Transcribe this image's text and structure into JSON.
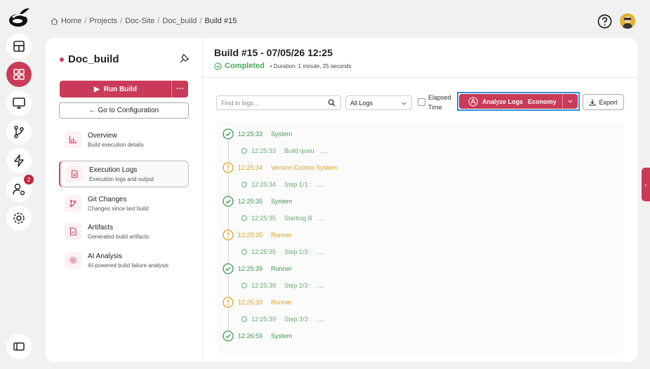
{
  "breadcrumb": [
    "Home",
    "Projects",
    "Doc-Site",
    "Doc_build",
    "Build #15"
  ],
  "colors": {
    "accent": "#c93b58",
    "success": "#4aa85a",
    "warning": "#e0a022",
    "highlight": "#2f8fd8"
  },
  "rail": {
    "icons": [
      "logo-icon",
      "dashboard-icon",
      "apps-grid-icon",
      "monitor-icon",
      "git-branch-icon",
      "lightning-icon",
      "user-settings-icon",
      "settings-gear-icon",
      "sidebar-toggle-icon"
    ],
    "user_badge": "2"
  },
  "sidebar": {
    "project_name": "Doc_build",
    "run_build": "Run Build",
    "run_more": "···",
    "go_config": "← Go to Configuration",
    "items": [
      {
        "label": "Overview",
        "desc": "Build execution details",
        "icon": "chart-icon"
      },
      {
        "label": "Execution Logs",
        "desc": "Execution logs and output",
        "icon": "document-icon"
      },
      {
        "label": "Git Changes",
        "desc": "Changes since last build",
        "icon": "git-branch-icon"
      },
      {
        "label": "Artifacts",
        "desc": "Generated build artifacts",
        "icon": "file-icon"
      },
      {
        "label": "AI Analysis",
        "desc": "AI-powered build failure analysis",
        "icon": "gear-icon"
      }
    ]
  },
  "header": {
    "title": "Build #15 - 07/05/26 12:25",
    "status": "Completed",
    "duration": "• Duration: 1 minute, 25 seconds"
  },
  "toolbar": {
    "search_placeholder": "Find in logs...",
    "filter_selected": "All Logs",
    "elapsed_label": "Elapsed Time",
    "analyze_label": "Analyze Logs",
    "analyze_tier": "Economy",
    "export_label": "Export"
  },
  "logs": [
    {
      "kind": "step",
      "status": "success",
      "time": "12:25:33",
      "msg": "System"
    },
    {
      "kind": "sub",
      "time": "12:25:33",
      "msg": "Build queu",
      "ellipsis": "..."
    },
    {
      "kind": "step",
      "status": "warning",
      "time": "12:25:34",
      "msg": "Version Control System"
    },
    {
      "kind": "sub",
      "time": "12:25:34",
      "msg": "Step 1/1 :",
      "ellipsis": "..."
    },
    {
      "kind": "step",
      "status": "success",
      "time": "12:25:35",
      "msg": "System"
    },
    {
      "kind": "sub",
      "time": "12:25:35",
      "msg": "Starting B",
      "ellipsis": "..."
    },
    {
      "kind": "step",
      "status": "warning",
      "time": "12:25:35",
      "msg": "Runner"
    },
    {
      "kind": "sub",
      "time": "12:25:35",
      "msg": "Step 1/3 :",
      "ellipsis": "..."
    },
    {
      "kind": "step",
      "status": "success",
      "time": "12:25:39",
      "msg": "Runner"
    },
    {
      "kind": "sub",
      "time": "12:25:39",
      "msg": "Step 2/3 :",
      "ellipsis": "..."
    },
    {
      "kind": "step",
      "status": "warning",
      "time": "12:25:39",
      "msg": "Runner"
    },
    {
      "kind": "sub",
      "time": "12:25:39",
      "msg": "Step 3/3 :",
      "ellipsis": "..."
    },
    {
      "kind": "step",
      "status": "success",
      "time": "12:26:59",
      "msg": "System"
    }
  ]
}
